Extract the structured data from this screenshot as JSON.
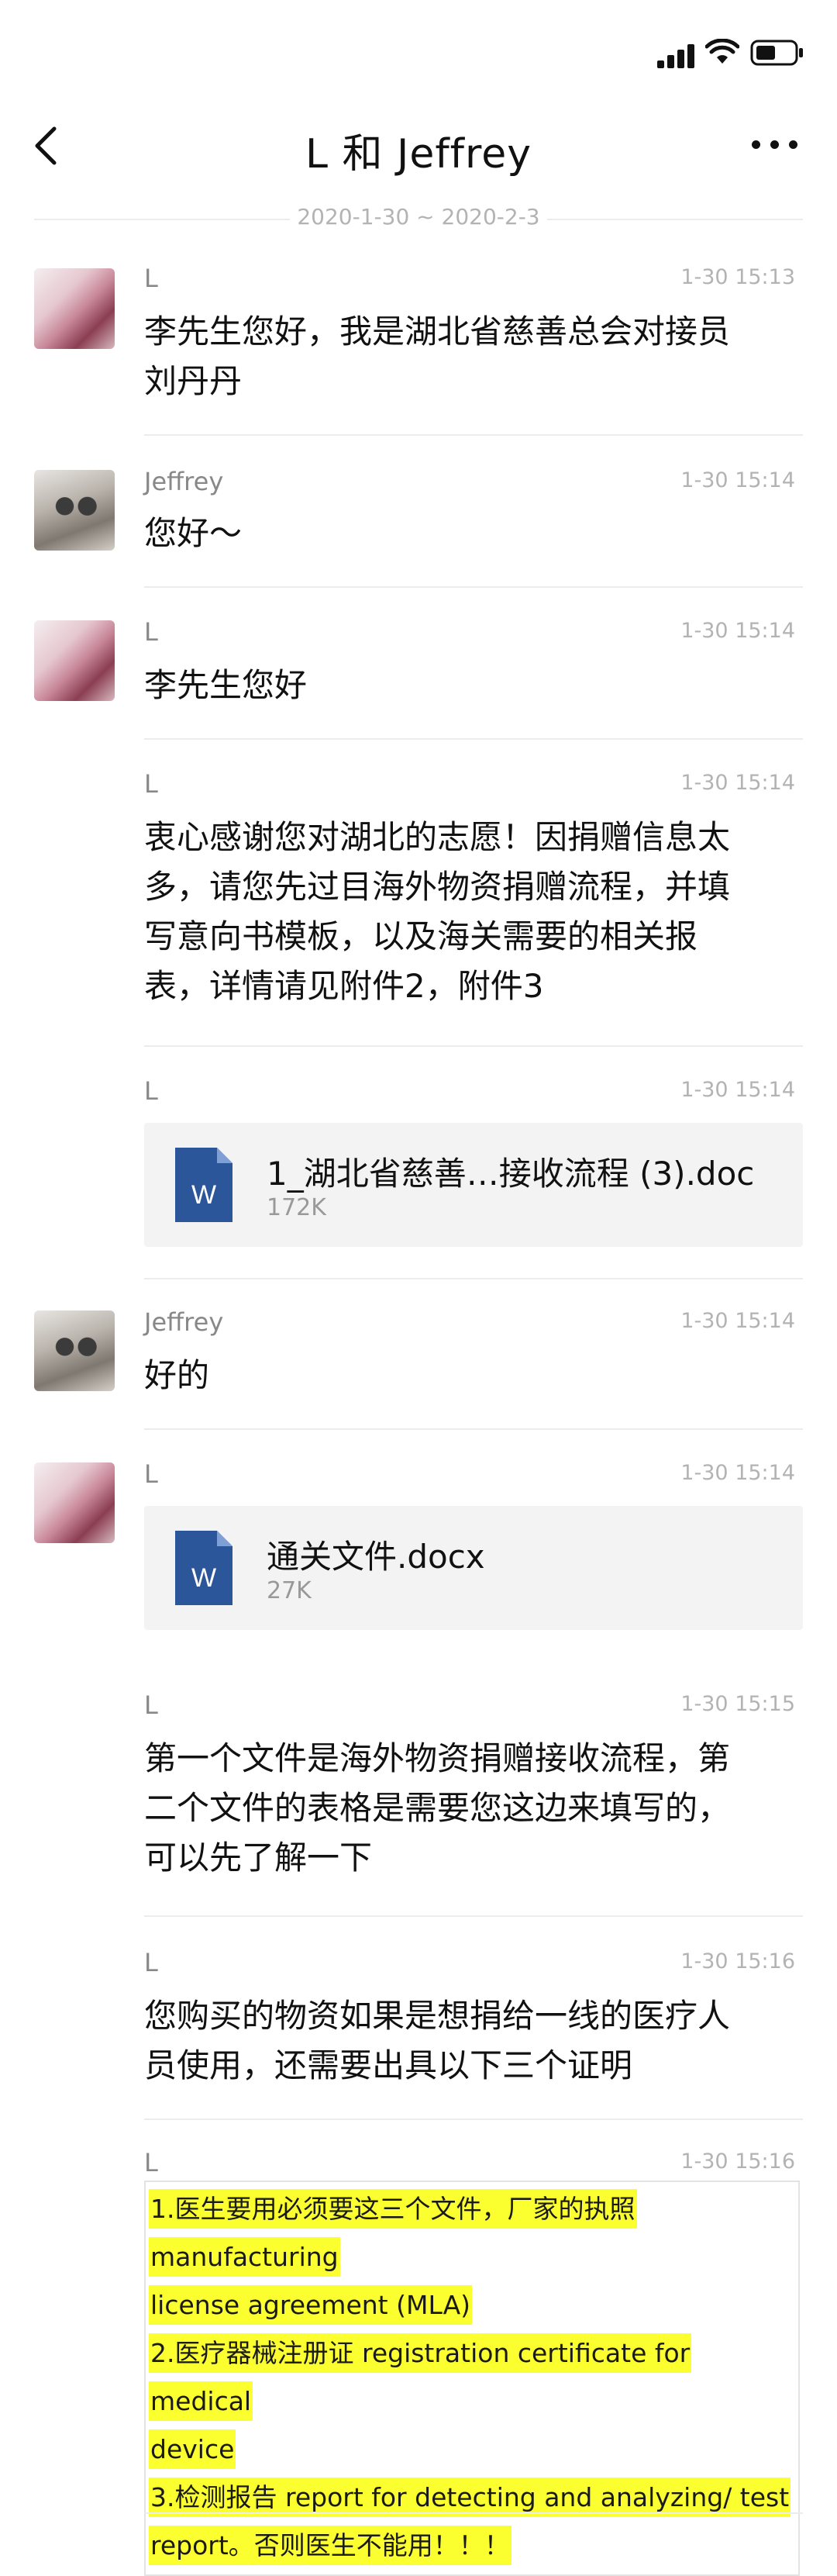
{
  "chat": {
    "title": "L 和 Jeffrey",
    "date_range": "2020-1-30 ~ 2020-2-3"
  },
  "icons": {
    "back": "chevron-left-icon",
    "more": "more-dots-icon",
    "signal": "cellular-signal-icon",
    "wifi": "wifi-icon",
    "battery": "battery-icon",
    "file": "word-doc-icon"
  },
  "messages": [
    {
      "sender": "L",
      "time": "1-30 15:13",
      "lines": [
        "李先生您好，我是湖北省慈善总会对接员",
        "刘丹丹"
      ]
    },
    {
      "sender": "Jeffrey",
      "time": "1-30 15:14",
      "lines": [
        "您好～"
      ]
    },
    {
      "sender": "L",
      "time": "1-30 15:14",
      "lines": [
        "李先生您好"
      ]
    },
    {
      "sender": "L",
      "time": "1-30 15:14",
      "lines": [
        "衷心感谢您对湖北的志愿！因捐赠信息太",
        "多，请您先过目海外物资捐赠流程，并填",
        "写意向书模板，以及海关需要的相关报",
        "表，详情请见附件2，附件3"
      ]
    },
    {
      "sender": "L",
      "time": "1-30 15:14",
      "file": {
        "name": "1_湖北省慈善…接收流程 (3).doc",
        "size": "172K",
        "icon_letter": "W"
      }
    },
    {
      "sender": "Jeffrey",
      "time": "1-30 15:14",
      "lines": [
        "好的"
      ]
    },
    {
      "sender": "L",
      "time": "1-30 15:14",
      "file": {
        "name": "通关文件.docx",
        "size": "27K",
        "icon_letter": "W"
      }
    },
    {
      "sender": "L",
      "time": "1-30 15:15",
      "lines": [
        "第一个文件是海外物资捐赠接收流程，第",
        "二个文件的表格是需要您这边来填写的，",
        "可以先了解一下"
      ]
    },
    {
      "sender": "L",
      "time": "1-30 15:16",
      "lines": [
        "您购买的物资如果是想捐给一线的医疗人",
        "员使用，还需要出具以下三个证明"
      ]
    },
    {
      "sender": "L",
      "time": "1-30 15:16",
      "highlight_lines": [
        "1.医生要用必须要这三个文件，厂家的执照  manufacturing",
        "license agreement (MLA)",
        "2.医疗器械注册证  registration certificate for medical",
        "device",
        "3.检测报告   report for detecting and analyzing/ test",
        "report。否则医生不能用！！！"
      ]
    }
  ],
  "colors": {
    "highlight": "#fbff2f",
    "word_blue": "#2b579a",
    "muted_text": "#b3b3b3"
  }
}
